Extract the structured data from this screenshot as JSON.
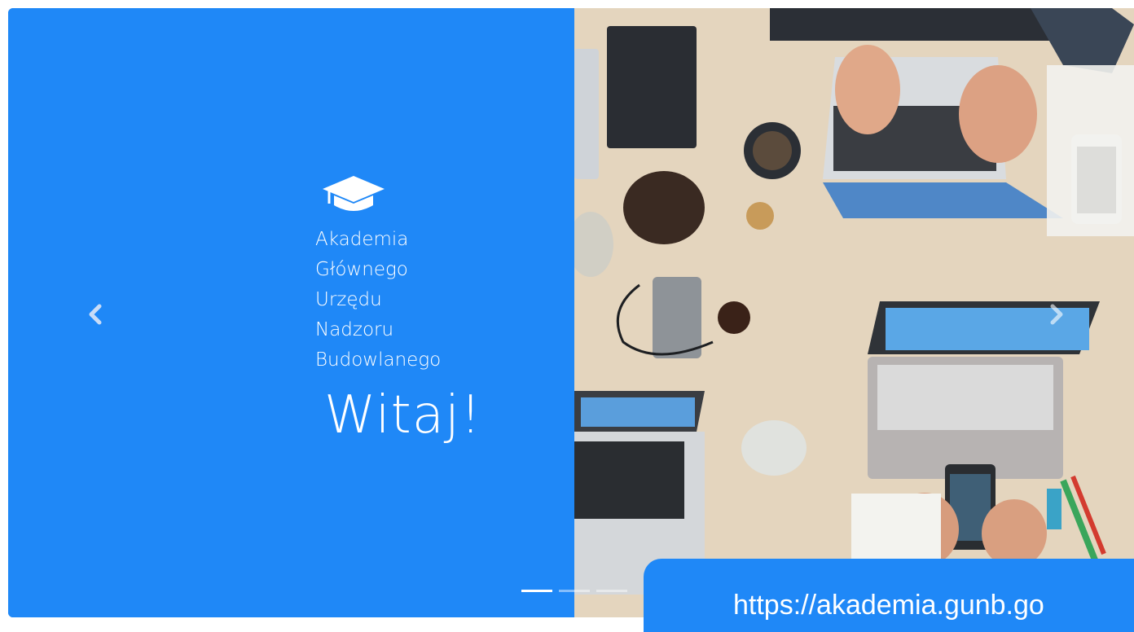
{
  "slide": {
    "brand_lines": [
      "Akademia",
      "Głównego",
      "Urzędu",
      "Nadzoru",
      "Budowlanego"
    ],
    "welcome": "Witaj!",
    "icon": "graduation-cap-icon"
  },
  "controls": {
    "prev_icon": "chevron-left-icon",
    "next_icon": "chevron-right-icon",
    "indicator_count": 3,
    "active_indicator": 1
  },
  "banner": {
    "url": "https://akademia.gunb.go"
  },
  "colors": {
    "accent": "#1f88f7",
    "text": "#ffffff"
  }
}
